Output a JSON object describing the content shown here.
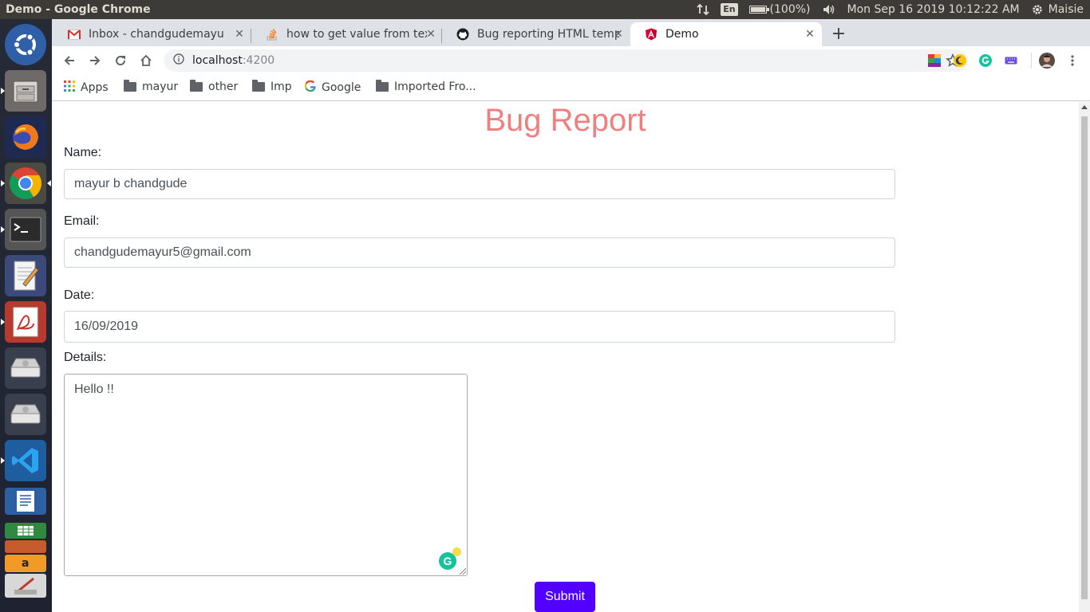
{
  "topbar": {
    "window_title": "Demo - Google Chrome",
    "input_method": "En",
    "battery": "(100%)",
    "clock": "Mon Sep 16 2019 10:12:22 AM",
    "user": "Maisie"
  },
  "launcher": {
    "apps": [
      "ubuntu-dash-icon",
      "files-icon",
      "firefox-icon",
      "chrome-icon",
      "terminal-icon",
      "text-editor-icon",
      "pdf-viewer-icon",
      "drive-icon",
      "drive-icon",
      "vscode-icon",
      "writer-icon",
      "calc-icon",
      "impress-icon",
      "amazon-icon",
      "installer-icon"
    ]
  },
  "tabs": [
    {
      "label": "Inbox - chandgudemayur5",
      "icon": "gmail-icon",
      "active": false
    },
    {
      "label": "how to get value from tex",
      "icon": "stackoverflow-icon",
      "active": false
    },
    {
      "label": "Bug reporting HTML temp",
      "icon": "github-icon",
      "active": false
    },
    {
      "label": "Demo",
      "icon": "angular-icon",
      "active": true
    }
  ],
  "address": {
    "host": "localhost",
    "port": ":4200"
  },
  "bookmarks": [
    {
      "label": "Apps",
      "icon": "apps-grid-icon"
    },
    {
      "label": "mayur",
      "icon": "folder-icon"
    },
    {
      "label": "other",
      "icon": "folder-icon"
    },
    {
      "label": "Imp",
      "icon": "folder-icon"
    },
    {
      "label": "Google",
      "icon": "google-icon"
    },
    {
      "label": "Imported Fro...",
      "icon": "folder-icon"
    }
  ],
  "form": {
    "title": "Bug Report",
    "name_label": "Name:",
    "name_value": "mayur b chandgude",
    "email_label": "Email:",
    "email_value": "chandgudemayur5@gmail.com",
    "date_label": "Date:",
    "date_value": "16/09/2019",
    "details_label": "Details:",
    "details_value": "Hello !!",
    "submit_label": "Submit"
  },
  "colors": {
    "title": "#f08080",
    "submit_bg": "#5200ff",
    "tabstrip": "#dee1e6"
  }
}
